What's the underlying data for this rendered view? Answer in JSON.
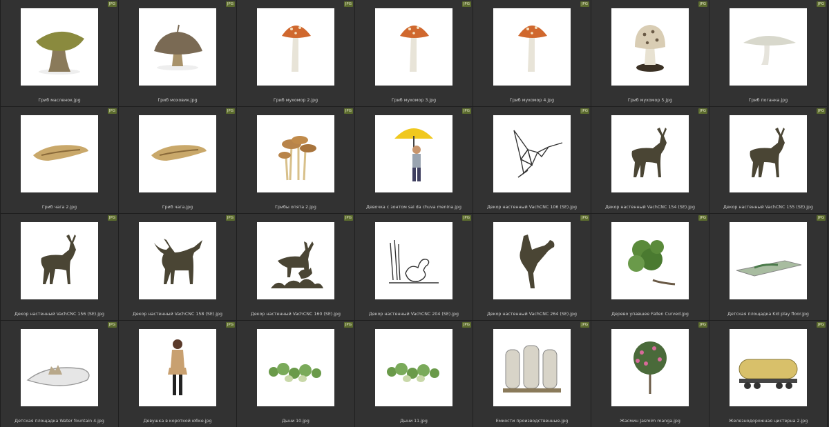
{
  "badge_text": "JPG",
  "colors": {
    "background": "#2b2b2b",
    "cell": "#323232",
    "badge": "#5b6b2e",
    "label": "#cfcfcf",
    "silhouette": "#4a4534"
  },
  "items": [
    {
      "label": "Гриб масленок.jpg",
      "icon": "mushroom-buttercup-icon"
    },
    {
      "label": "Гриб моховик.jpg",
      "icon": "mushroom-moss-icon"
    },
    {
      "label": "Гриб мухомор 2.jpg",
      "icon": "mushroom-amanita-icon"
    },
    {
      "label": "Гриб мухомор 3.jpg",
      "icon": "mushroom-amanita-icon"
    },
    {
      "label": "Гриб мухомор 4.jpg",
      "icon": "mushroom-amanita-icon"
    },
    {
      "label": "Гриб мухомор 5.jpg",
      "icon": "mushroom-panther-icon"
    },
    {
      "label": "Гриб поганка.jpg",
      "icon": "mushroom-toadstool-icon"
    },
    {
      "label": "Гриб чага 2.jpg",
      "icon": "chaga-icon"
    },
    {
      "label": "Гриб чага.jpg",
      "icon": "chaga-icon"
    },
    {
      "label": "Грибы опята 2.jpg",
      "icon": "honey-mushrooms-icon"
    },
    {
      "label": "Девочка с зонтом sai da chuva menina.jpg",
      "icon": "girl-umbrella-icon"
    },
    {
      "label": "Декор настенный VachCNC 106 (SE).jpg",
      "icon": "hummingbird-icon"
    },
    {
      "label": "Декор настенный VachCNC 154 (SE).jpg",
      "icon": "deer-icon"
    },
    {
      "label": "Декор настенный VachCNC 155 (SE).jpg",
      "icon": "deer-icon"
    },
    {
      "label": "Декор настенный VachCNC 156 (SE).jpg",
      "icon": "deer-icon"
    },
    {
      "label": "Декор настенный VachCNC 158 (SE).jpg",
      "icon": "moose-icon"
    },
    {
      "label": "Декор настенный VachCNC 160 (SE).jpg",
      "icon": "deer-scene-icon"
    },
    {
      "label": "Декор настенный VachCNC 204 (SE).jpg",
      "icon": "duck-icon"
    },
    {
      "label": "Декор настенный VachCNC 264 (SE).jpg",
      "icon": "breakdancer-icon"
    },
    {
      "label": "Дерево упавшее Fallen Curved.jpg",
      "icon": "tree-icon"
    },
    {
      "label": "Детская площадка Kid play floor.jpg",
      "icon": "playground-icon"
    },
    {
      "label": "Детская площадка Water fountain 4.jpg",
      "icon": "fountain-icon"
    },
    {
      "label": "Девушка в короткой юбке.jpg",
      "icon": "woman-icon"
    },
    {
      "label": "Дыни 10.jpg",
      "icon": "melon-vine-icon"
    },
    {
      "label": "Дыни 11.jpg",
      "icon": "melon-vine-icon"
    },
    {
      "label": "Емкости производственные.jpg",
      "icon": "tanks-icon"
    },
    {
      "label": "Жасмин Jasmim manga.jpg",
      "icon": "jasmine-tree-icon"
    },
    {
      "label": "Железнодорожная цистерна 2.jpg",
      "icon": "tank-car-icon"
    }
  ]
}
